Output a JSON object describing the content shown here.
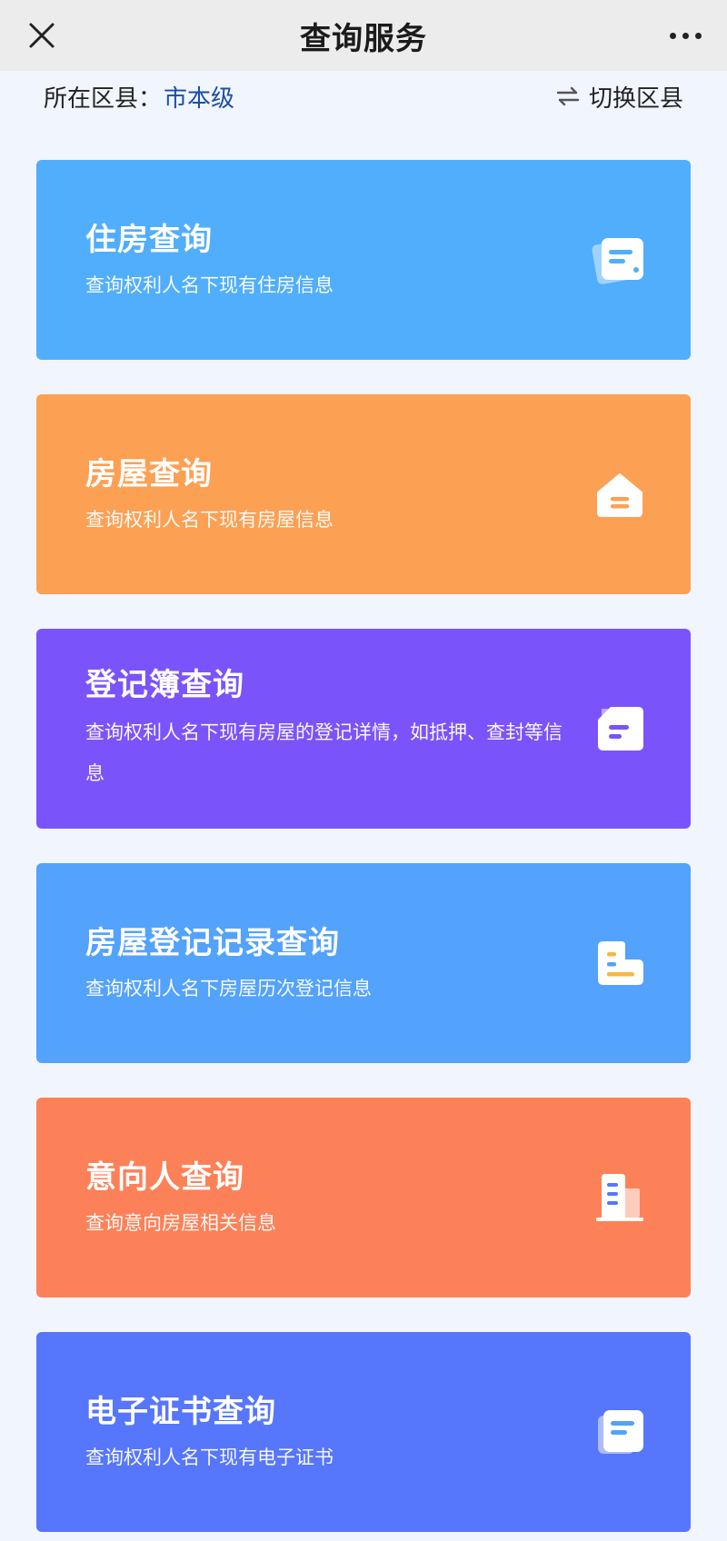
{
  "header": {
    "title": "查询服务"
  },
  "district": {
    "label": "所在区县：",
    "value": "市本级",
    "switch_label": "切换区县"
  },
  "cards": [
    {
      "title": "住房查询",
      "desc": "查询权利人名下现有住房信息",
      "color": "#51aefc",
      "icon": "document-list-icon"
    },
    {
      "title": "房屋查询",
      "desc": "查询权利人名下现有房屋信息",
      "color": "#fca054",
      "icon": "house-icon"
    },
    {
      "title": "登记簿查询",
      "desc": "查询权利人名下现有房屋的登记详情，如抵押、查封等信息",
      "color": "#7b53fa",
      "icon": "register-book-icon"
    },
    {
      "title": "房屋登记记录查询",
      "desc": "查询权利人名下房屋历次登记信息",
      "color": "#53a2fc",
      "icon": "record-icon"
    },
    {
      "title": "意向人查询",
      "desc": "查询意向房屋相关信息",
      "color": "#fc8158",
      "icon": "building-icon"
    },
    {
      "title": "电子证书查询",
      "desc": "查询权利人名下现有电子证书",
      "color": "#5676fc",
      "icon": "certificate-icon"
    }
  ]
}
